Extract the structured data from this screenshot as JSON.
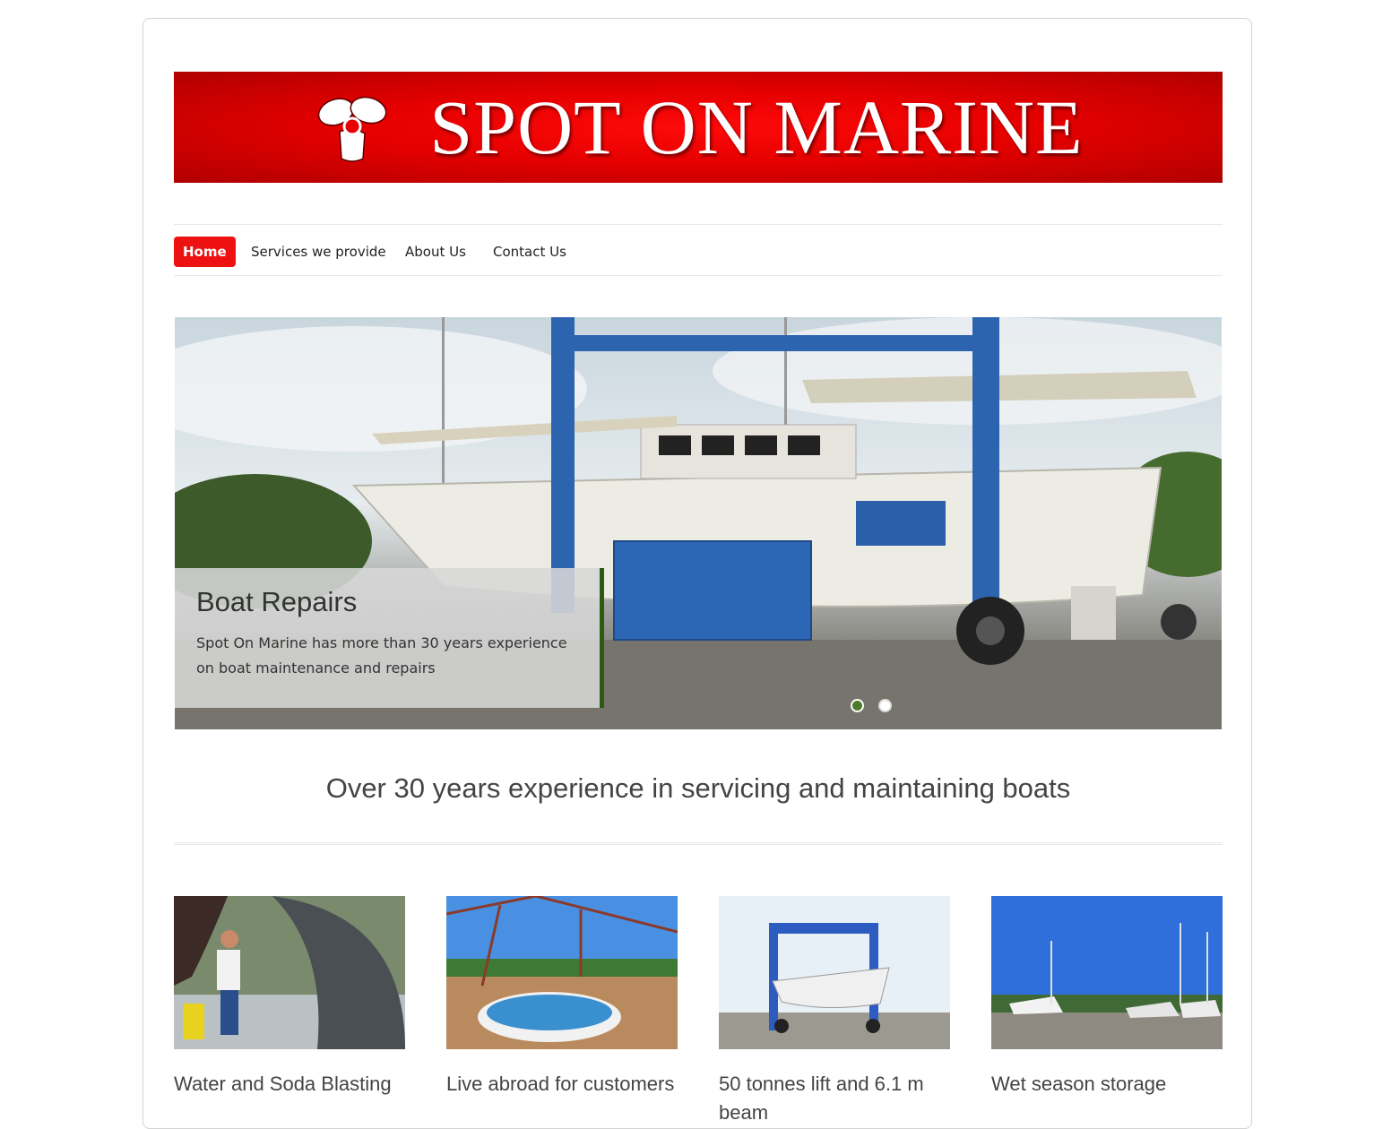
{
  "brand": {
    "name": "SPOT ON MARINE",
    "logo_icon": "propeller-icon",
    "color": "#e60000"
  },
  "nav": {
    "items": [
      {
        "label": "Home",
        "active": true
      },
      {
        "label": "Services we provide",
        "active": false
      },
      {
        "label": "About Us",
        "active": false
      },
      {
        "label": "Contact Us",
        "active": false
      }
    ],
    "active_color": "#ee1111"
  },
  "hero": {
    "title": "Boat Repairs",
    "text": "Spot On Marine has more than 30 years experience on boat maintenance and repairs",
    "slide_count": 2,
    "active_slide": 1,
    "accent_color": "#2c5a12"
  },
  "tagline": "Over 30 years experience in servicing and maintaining boats",
  "services": [
    {
      "title": "Water and Soda Blasting"
    },
    {
      "title": "Live abroad for customers"
    },
    {
      "title": "50 tonnes lift and 6.1 m beam"
    },
    {
      "title": "Wet season storage"
    }
  ]
}
